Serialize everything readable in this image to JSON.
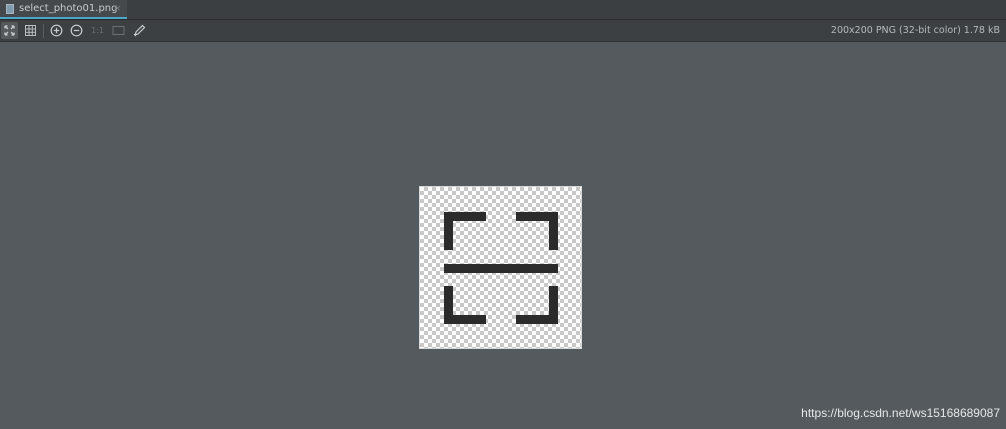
{
  "tab": {
    "filename": "select_photo01.png",
    "close_glyph": "×",
    "accent_color": "#4aa8c9"
  },
  "toolbar": {
    "buttons": [
      {
        "name": "fit-to-window-icon",
        "active": true
      },
      {
        "name": "grid-icon",
        "active": false
      },
      {
        "name": "zoom-in-icon",
        "active": false
      },
      {
        "name": "zoom-out-icon",
        "active": false
      },
      {
        "name": "actual-size-icon",
        "active": false
      },
      {
        "name": "background-icon",
        "active": false
      },
      {
        "name": "color-picker-icon",
        "active": false
      }
    ],
    "actual_size_label": "1:1",
    "image_info": "200x200 PNG (32-bit color) 1.78 kB"
  },
  "canvas": {
    "background_color": "#545a5d",
    "image_icon": "scan-frame-icon",
    "icon_color": "#2b2b2b"
  },
  "watermark": {
    "text": "https://blog.csdn.net/ws15168689087"
  }
}
